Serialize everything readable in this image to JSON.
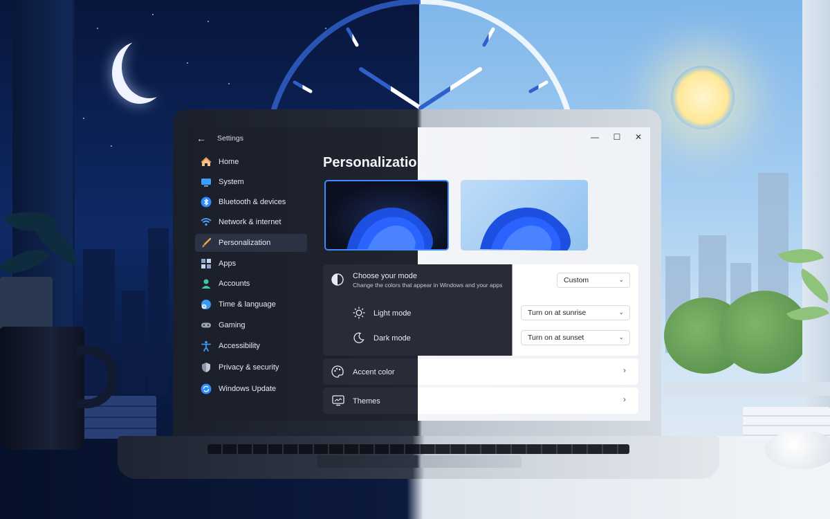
{
  "window": {
    "title": "Settings",
    "back_glyph": "←",
    "minimize_glyph": "—",
    "maximize_glyph": "☐",
    "close_glyph": "✕"
  },
  "sidebar": {
    "items": [
      {
        "label": "Home",
        "icon": "home-icon"
      },
      {
        "label": "System",
        "icon": "system-icon"
      },
      {
        "label": "Bluetooth & devices",
        "icon": "bluetooth-icon"
      },
      {
        "label": "Network & internet",
        "icon": "wifi-icon"
      },
      {
        "label": "Personalization",
        "icon": "brush-icon",
        "active": true
      },
      {
        "label": "Apps",
        "icon": "apps-icon"
      },
      {
        "label": "Accounts",
        "icon": "account-icon"
      },
      {
        "label": "Time & language",
        "icon": "globe-clock-icon"
      },
      {
        "label": "Gaming",
        "icon": "gamepad-icon"
      },
      {
        "label": "Accessibility",
        "icon": "accessibility-icon"
      },
      {
        "label": "Privacy & security",
        "icon": "shield-icon"
      },
      {
        "label": "Windows Update",
        "icon": "update-icon"
      }
    ]
  },
  "main": {
    "title": "Personalization",
    "mode": {
      "title": "Choose your mode",
      "subtitle": "Change the colors that appear in Windows and your apps",
      "value": "Custom",
      "light_label": "Light mode",
      "light_value": "Turn on at sunrise",
      "dark_label": "Dark mode",
      "dark_value": "Turn on at sunset"
    },
    "accent_label": "Accent color",
    "themes_label": "Themes",
    "chevron_right": "›",
    "chevron_down": "⌄"
  },
  "colors": {
    "accent": "#3d8bff",
    "dark_surface": "#1b1f2a",
    "light_surface": "#f3f5f8"
  }
}
